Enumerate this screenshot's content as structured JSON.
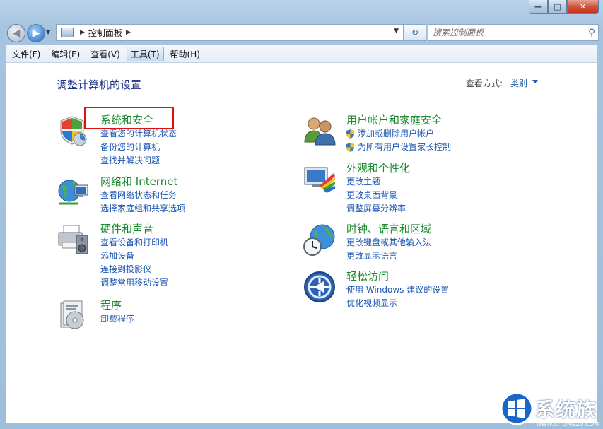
{
  "window": {
    "buttons": {
      "minimize": "—",
      "maximize": "□",
      "close": "✕"
    }
  },
  "navigation": {
    "breadcrumb": [
      "控制面板"
    ],
    "search_placeholder": "搜索控制面板"
  },
  "menu": [
    "文件(F)",
    "编辑(E)",
    "查看(V)",
    "工具(T)",
    "帮助(H)"
  ],
  "active_menu_index": 3,
  "content": {
    "title": "调整计算机的设置",
    "view_by_label": "查看方式:",
    "view_by_value": "类别"
  },
  "categories": [
    {
      "title": "系统和安全",
      "icon": "shield-icon",
      "links": [
        "查看您的计算机状态",
        "备份您的计算机",
        "查找并解决问题"
      ]
    },
    {
      "title": "网络和 Internet",
      "icon": "network-globe-icon",
      "links": [
        "查看网络状态和任务",
        "选择家庭组和共享选项"
      ]
    },
    {
      "title": "硬件和声音",
      "icon": "printer-speaker-icon",
      "links": [
        "查看设备和打印机",
        "添加设备",
        "连接到投影仪",
        "调整常用移动设置"
      ]
    },
    {
      "title": "程序",
      "icon": "programs-icon",
      "links": [
        "卸载程序"
      ]
    },
    {
      "title": "用户帐户和家庭安全",
      "icon": "users-icon",
      "links": [
        "添加或删除用户帐户",
        "为所有用户设置家长控制"
      ]
    },
    {
      "title": "外观和个性化",
      "icon": "monitor-palette-icon",
      "links": [
        "更改主题",
        "更改桌面背景",
        "调整屏幕分辨率"
      ]
    },
    {
      "title": "时钟、语言和区域",
      "icon": "clock-globe-icon",
      "links": [
        "更改键盘或其他输入法",
        "更改显示语言"
      ]
    },
    {
      "title": "轻松访问",
      "icon": "ease-of-access-icon",
      "links": [
        "使用 Windows 建议的设置",
        "优化视频显示"
      ]
    }
  ],
  "watermark": {
    "text": "系统族",
    "sub": "WWW.XITONGZU.COM"
  },
  "colors": {
    "category_title": "#1b8a2f",
    "link": "#1c56b3",
    "highlight_box": "#dd1111",
    "page_title": "#1e3287"
  }
}
